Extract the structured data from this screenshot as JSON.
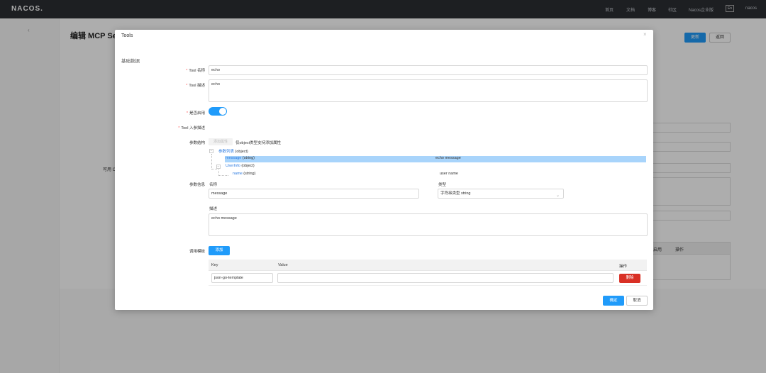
{
  "nav": {
    "logo": "NACOS.",
    "links": [
      "首页",
      "文档",
      "博客",
      "社区",
      "Nacos企业版"
    ],
    "lang": "En",
    "user": "nacos"
  },
  "background": {
    "title": "编辑 MCP Se",
    "update_button": "更新",
    "back_button": "返回",
    "visible_label": "可用 C",
    "table_headers": [
      "启用",
      "操作"
    ]
  },
  "dialog": {
    "title": "Tools",
    "section_title": "基础数据",
    "tool_name": {
      "label": "Tool 名称",
      "value": "echo"
    },
    "tool_desc": {
      "label": "Tool 描述",
      "value": "echo"
    },
    "enabled": {
      "label": "是否启用",
      "on": true
    },
    "input_schema": {
      "label": "Tool 入参描述"
    },
    "param_structure": {
      "label": "参数结构",
      "add_prop_button": "添加属性",
      "hint": "仅object类型支持添加属性"
    },
    "tree": {
      "root": {
        "name": "参数列表",
        "type": "(object)"
      },
      "rows": [
        {
          "name": "message",
          "type": "(string)",
          "desc": "echo message",
          "selected": true
        },
        {
          "name": "UserInfo",
          "type": "(object)",
          "desc": ""
        },
        {
          "name": "name",
          "type": "(string)",
          "desc": "user name"
        }
      ]
    },
    "param_info": {
      "label": "参数信息",
      "name_label": "名称",
      "name_value": "message",
      "type_label": "类型",
      "type_value": "字符串类型 string",
      "desc_label": "描述",
      "desc_value": "echo message"
    },
    "template": {
      "label": "调用模板",
      "add_button": "添加",
      "headers": {
        "key": "Key",
        "value": "Value",
        "op": "操作"
      },
      "rows": [
        {
          "key": "json-go-template",
          "value": "",
          "delete": "删除"
        }
      ]
    },
    "footer": {
      "ok": "确定",
      "cancel": "取消"
    }
  },
  "colors": {
    "primary": "#209bfa",
    "danger": "#d93025",
    "nav_bg": "#2b2e33",
    "selected_row": "#a8d4fb"
  },
  "icons": {
    "close": "close-icon",
    "back": "chevron-left-icon",
    "select": "chevron-down-icon"
  }
}
